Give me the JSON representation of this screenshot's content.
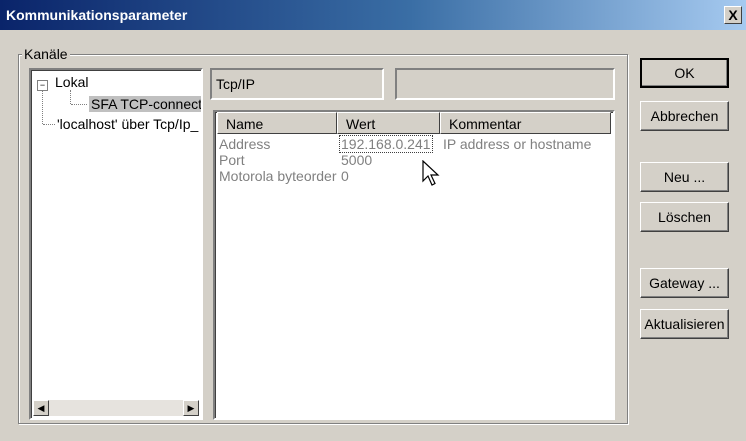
{
  "window": {
    "title": "Kommunikationsparameter",
    "close_label": "X"
  },
  "channels_group": {
    "label": "Kanäle"
  },
  "tree": {
    "items": [
      {
        "label": "Lokal",
        "expander": "−"
      },
      {
        "label": "SFA TCP-connectio"
      },
      {
        "label": "'localhost' über Tcp/Ip_"
      }
    ]
  },
  "driver": {
    "name": "Tcp/IP",
    "extra": ""
  },
  "params": {
    "columns": [
      "Name",
      "Wert",
      "Kommentar"
    ],
    "rows": [
      {
        "name": "Address",
        "value": "192.168.0.241",
        "comment": "IP address or hostname"
      },
      {
        "name": "Port",
        "value": "5000",
        "comment": ""
      },
      {
        "name": "Motorola byteorder",
        "value": "0",
        "comment": ""
      }
    ]
  },
  "buttons": {
    "ok": "OK",
    "cancel": "Abbrechen",
    "new": "Neu ...",
    "delete": "Löschen",
    "gateway": "Gateway ...",
    "refresh": "Aktualisieren"
  },
  "icons": {
    "close": "close-icon",
    "minus": "collapse-icon",
    "left": "arrow-left-icon",
    "right": "arrow-right-icon",
    "cursor": "mouse-pointer-icon"
  }
}
